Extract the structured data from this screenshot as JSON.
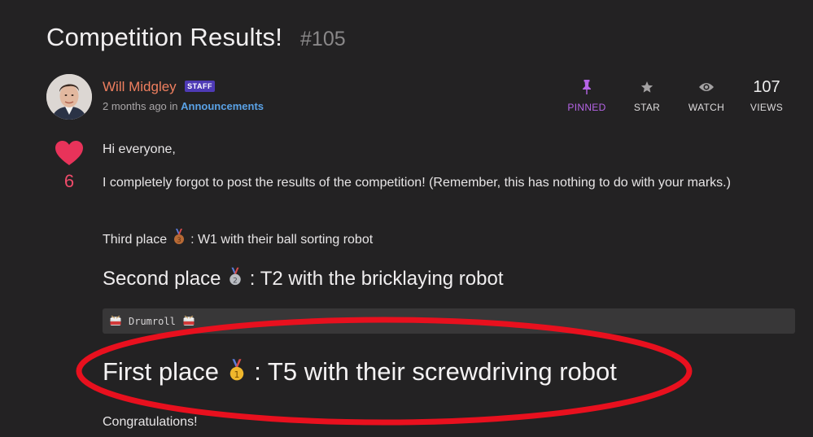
{
  "topic": {
    "title": "Competition Results!",
    "number": "#105"
  },
  "author": {
    "name": "Will Midgley",
    "badge": "STAFF",
    "time": "2 months ago",
    "in_text": "in",
    "category": "Announcements"
  },
  "stats": {
    "pinned_label": "PINNED",
    "star_label": "STAR",
    "watch_label": "WATCH",
    "views_count": "107",
    "views_label": "VIEWS"
  },
  "likes": {
    "count": "6"
  },
  "post": {
    "greeting": "Hi everyone,",
    "intro": "I completely forgot to post the results of the competition! (Remember, this has nothing to do with your marks.)",
    "third_prefix": "Third place",
    "third_suffix": ": W1 with their ball sorting robot",
    "second_prefix": "Second place",
    "second_suffix": ": T2 with the bricklaying robot",
    "code_text": "Drumroll",
    "first_prefix": "First place",
    "first_suffix": ": T5 with their screwdriving robot",
    "closing": "Congratulations!"
  },
  "colors": {
    "background": "#232223",
    "author_name": "#ef7f5f",
    "staff_badge": "#4e3ab5",
    "category_link": "#5aa2e6",
    "pinned_accent": "#b564e6",
    "heart": "#e8335a",
    "highlight_circle": "#e8101e"
  },
  "icons": {
    "pin": "pin-icon",
    "star": "star-icon",
    "watch": "eye-icon",
    "like": "heart-icon",
    "gold_medal": "gold-medal-icon",
    "silver_medal": "silver-medal-icon",
    "bronze_medal": "bronze-medal-icon",
    "drum": "drum-icon"
  }
}
